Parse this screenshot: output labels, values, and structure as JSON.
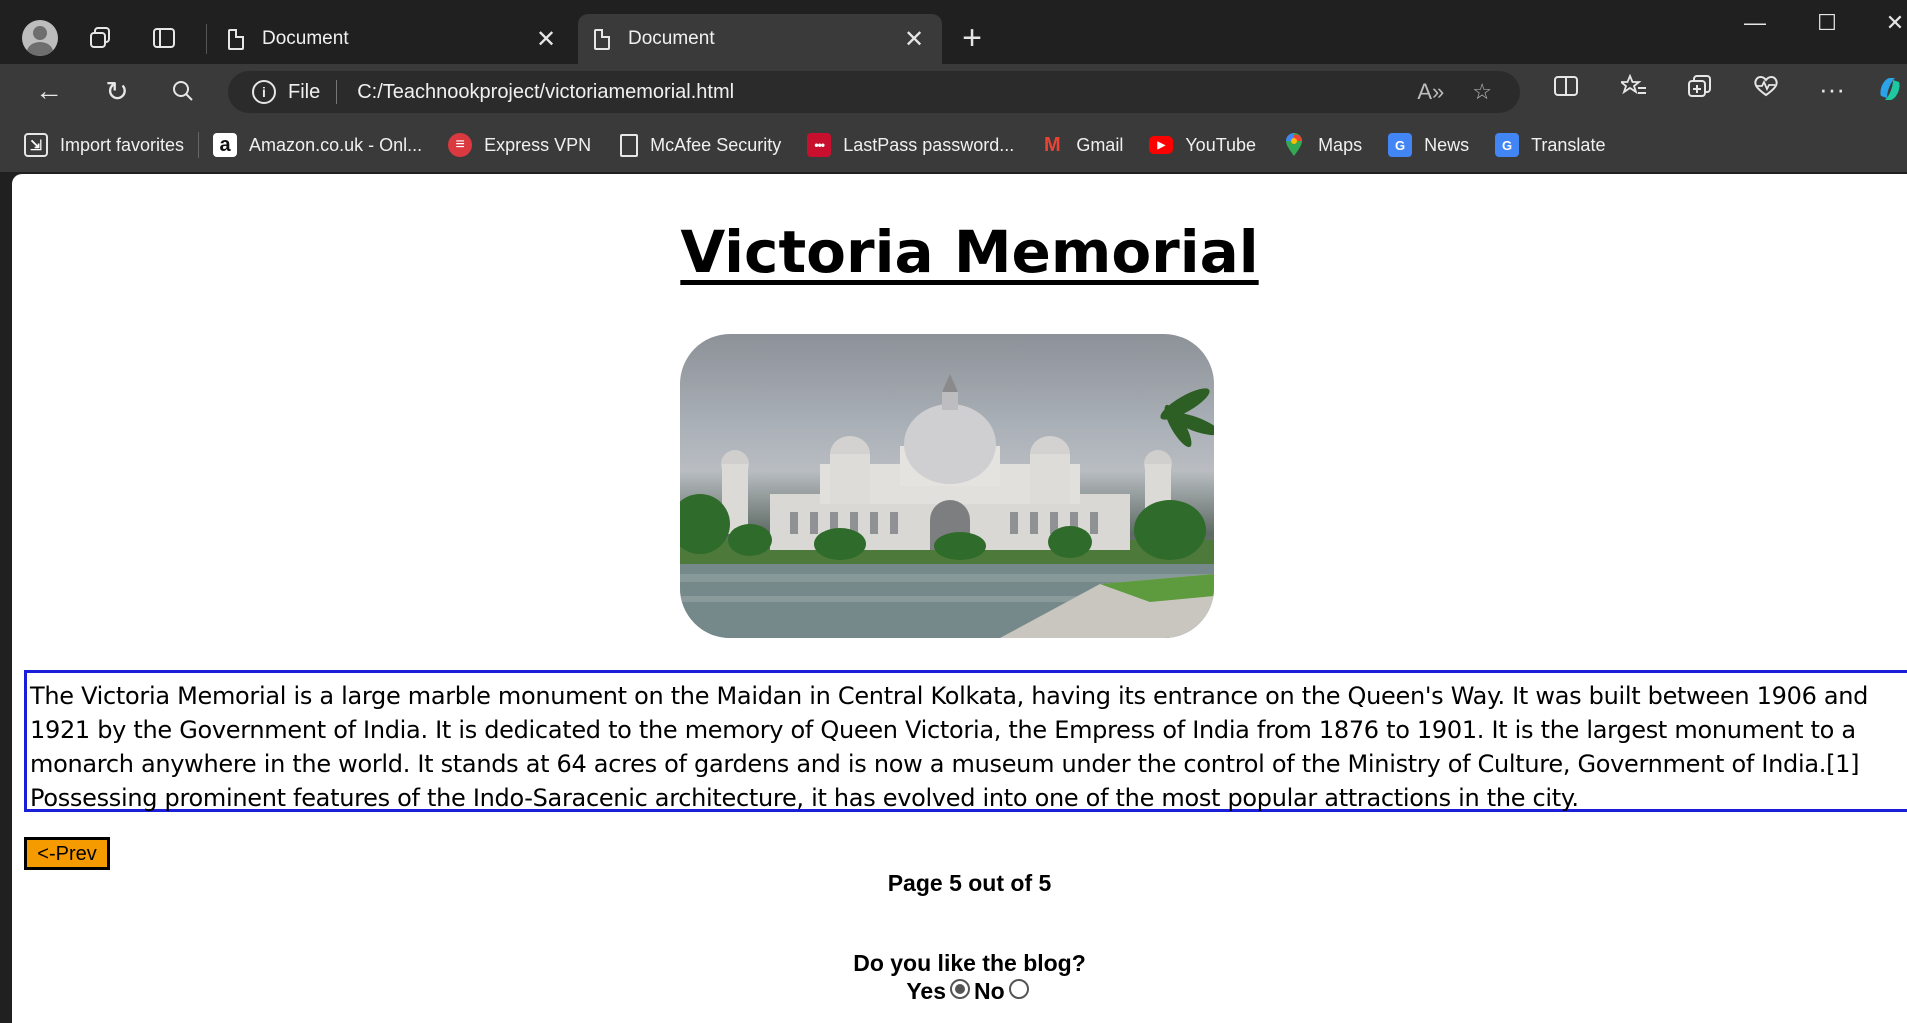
{
  "browser": {
    "tabs": [
      {
        "title": "Document",
        "close": "✕"
      },
      {
        "title": "Document",
        "close": "✕"
      }
    ],
    "new_tab": "+",
    "window_controls": {
      "minimize": "—",
      "maximize": "☐",
      "close": "✕"
    },
    "nav": {
      "back": "←",
      "reload": "↻",
      "search": "⌕"
    },
    "address": {
      "scheme": "File",
      "url": "C:/Teachnookproject/victoriamemorial.html"
    },
    "bookmarks": [
      {
        "label": "Import favorites",
        "icon": "import-icon",
        "glyph": "⇲",
        "color": "#3a3a3a"
      },
      {
        "label": "Amazon.co.uk - Onl...",
        "icon": "amazon-icon",
        "glyph": "a",
        "color": "#ffffff"
      },
      {
        "label": "Express VPN",
        "icon": "expressvpn-icon",
        "glyph": "≡",
        "color": "#da3940"
      },
      {
        "label": "McAfee Security",
        "icon": "page-icon",
        "glyph": "",
        "color": "#3a3a3a"
      },
      {
        "label": "LastPass password...",
        "icon": "lastpass-icon",
        "glyph": "•••",
        "color": "#c8102e"
      },
      {
        "label": "Gmail",
        "icon": "gmail-icon",
        "glyph": "M",
        "color": "#3a3a3a"
      },
      {
        "label": "YouTube",
        "icon": "youtube-icon",
        "glyph": "▶",
        "color": "#ff0000"
      },
      {
        "label": "Maps",
        "icon": "maps-icon",
        "glyph": "●",
        "color": "#3a3a3a"
      },
      {
        "label": "News",
        "icon": "news-icon",
        "glyph": "G",
        "color": "#4285f4"
      },
      {
        "label": "Translate",
        "icon": "translate-icon",
        "glyph": "G",
        "color": "#4285f4"
      }
    ]
  },
  "page": {
    "heading": "Victoria Memorial",
    "paragraph": "The Victoria Memorial is a large marble monument on the Maidan in Central Kolkata, having its entrance on the Queen's Way. It was built between 1906 and 1921 by the Government of India. It is dedicated to the memory of Queen Victoria, the Empress of India from 1876 to 1901. It is the largest monument to a monarch anywhere in the world. It stands at 64 acres of gardens and is now a museum under the control of the Ministry of Culture, Government of India.[1] Possessing prominent features of the Indo-Saracenic architecture, it has evolved into one of the most popular attractions in the city.",
    "prev_button": "<-Prev",
    "page_info": "Page 5 out of 5",
    "poll": {
      "question": "Do you like the blog?",
      "yes": "Yes",
      "no": "No",
      "selected": "Yes"
    }
  }
}
